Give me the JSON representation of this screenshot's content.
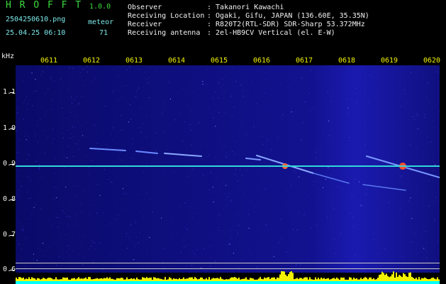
{
  "header": {
    "app_title": "H R O F F T",
    "version": "1.0.0",
    "filename": "2504250610.png",
    "meteor_label": "meteor",
    "datetime": "25.04.25 06:10",
    "meteor_count": "71"
  },
  "info": [
    {
      "label": "Observer",
      "value": ": Takanori Kawachi"
    },
    {
      "label": "Receiving Location",
      "value": ": Ogaki, Gifu, JAPAN (136.60E, 35.35N)"
    },
    {
      "label": "Receiver",
      "value": ": R820T2(RTL-SDR) SDR-Sharp 53.372MHz"
    },
    {
      "label": "Receiving antenna",
      "value": ": 2el-HB9CV Vertical (el. E-W)"
    }
  ],
  "y_axis": {
    "unit": "kHz",
    "ticks": [
      "1.1",
      "1.0",
      "0.9",
      "0.8",
      "0.7",
      "0.6"
    ]
  },
  "x_axis": {
    "ticks": [
      "0611",
      "0612",
      "0613",
      "0614",
      "0615",
      "0616",
      "0617",
      "0618",
      "0619",
      "0620"
    ]
  },
  "colors": {
    "background": "#000000",
    "spectrum_bg": "#08085c",
    "carrier_line": "#32d8d8",
    "header_green": "#3ddc3d",
    "tick_yellow": "#f2f200",
    "amplitude": "#f2f200",
    "baseline": "#00ffff"
  }
}
